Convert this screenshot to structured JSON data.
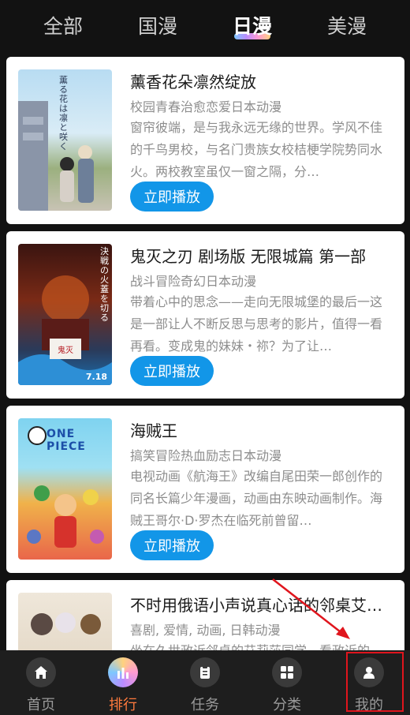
{
  "tabs": [
    "全部",
    "国漫",
    "日漫",
    "美漫"
  ],
  "play_label": "立即播放",
  "cards": [
    {
      "title": "薰香花朵凛然绽放",
      "tags": "校园青春治愈恋爱日本动漫",
      "desc": "窗帘彼端，是与我永远无缘的世界。学风不佳的千鸟男校，与名门贵族女校桔梗学院势同水火。两校教室虽仅一窗之隔，分…",
      "poster_text": "薫る花は凛と咲く"
    },
    {
      "title": "鬼灭之刃 剧场版 无限城篇 第一部",
      "tags": "战斗冒险奇幻日本动漫",
      "desc": "带着心中的思念——走向无限城堡的最后一这是一部让人不断反思与思考的影片，值得一看再看。变成鬼的妹妹・祢？为了让…",
      "poster_text": "決戦の火蓋を切る",
      "poster_date": "7.18"
    },
    {
      "title": "海贼王",
      "tags": "搞笑冒险热血励志日本动漫",
      "desc": "电视动画《航海王》改编自尾田荣一郎创作的同名长篇少年漫画，动画由东映动画制作。海贼王哥尔·D·罗杰在临死前曾留…",
      "poster_text": "ONE PIECE"
    },
    {
      "title": "不时用俄语小声说真心话的邻桌艾…",
      "tags": "喜剧, 爱情, 动画, 日韩动漫",
      "desc": "坐在久世政近邻桌的艾莉莎同学，看政近的…",
      "poster_text": ""
    }
  ],
  "bottom_nav": [
    {
      "label": "首页",
      "icon": "home-icon"
    },
    {
      "label": "排行",
      "icon": "ranking-icon"
    },
    {
      "label": "任务",
      "icon": "task-icon"
    },
    {
      "label": "分类",
      "icon": "category-icon"
    },
    {
      "label": "我的",
      "icon": "user-icon"
    }
  ],
  "colors": {
    "accent": "#1296e8",
    "active_nav": "#ff7a3d",
    "annotation": "#e0151d"
  }
}
